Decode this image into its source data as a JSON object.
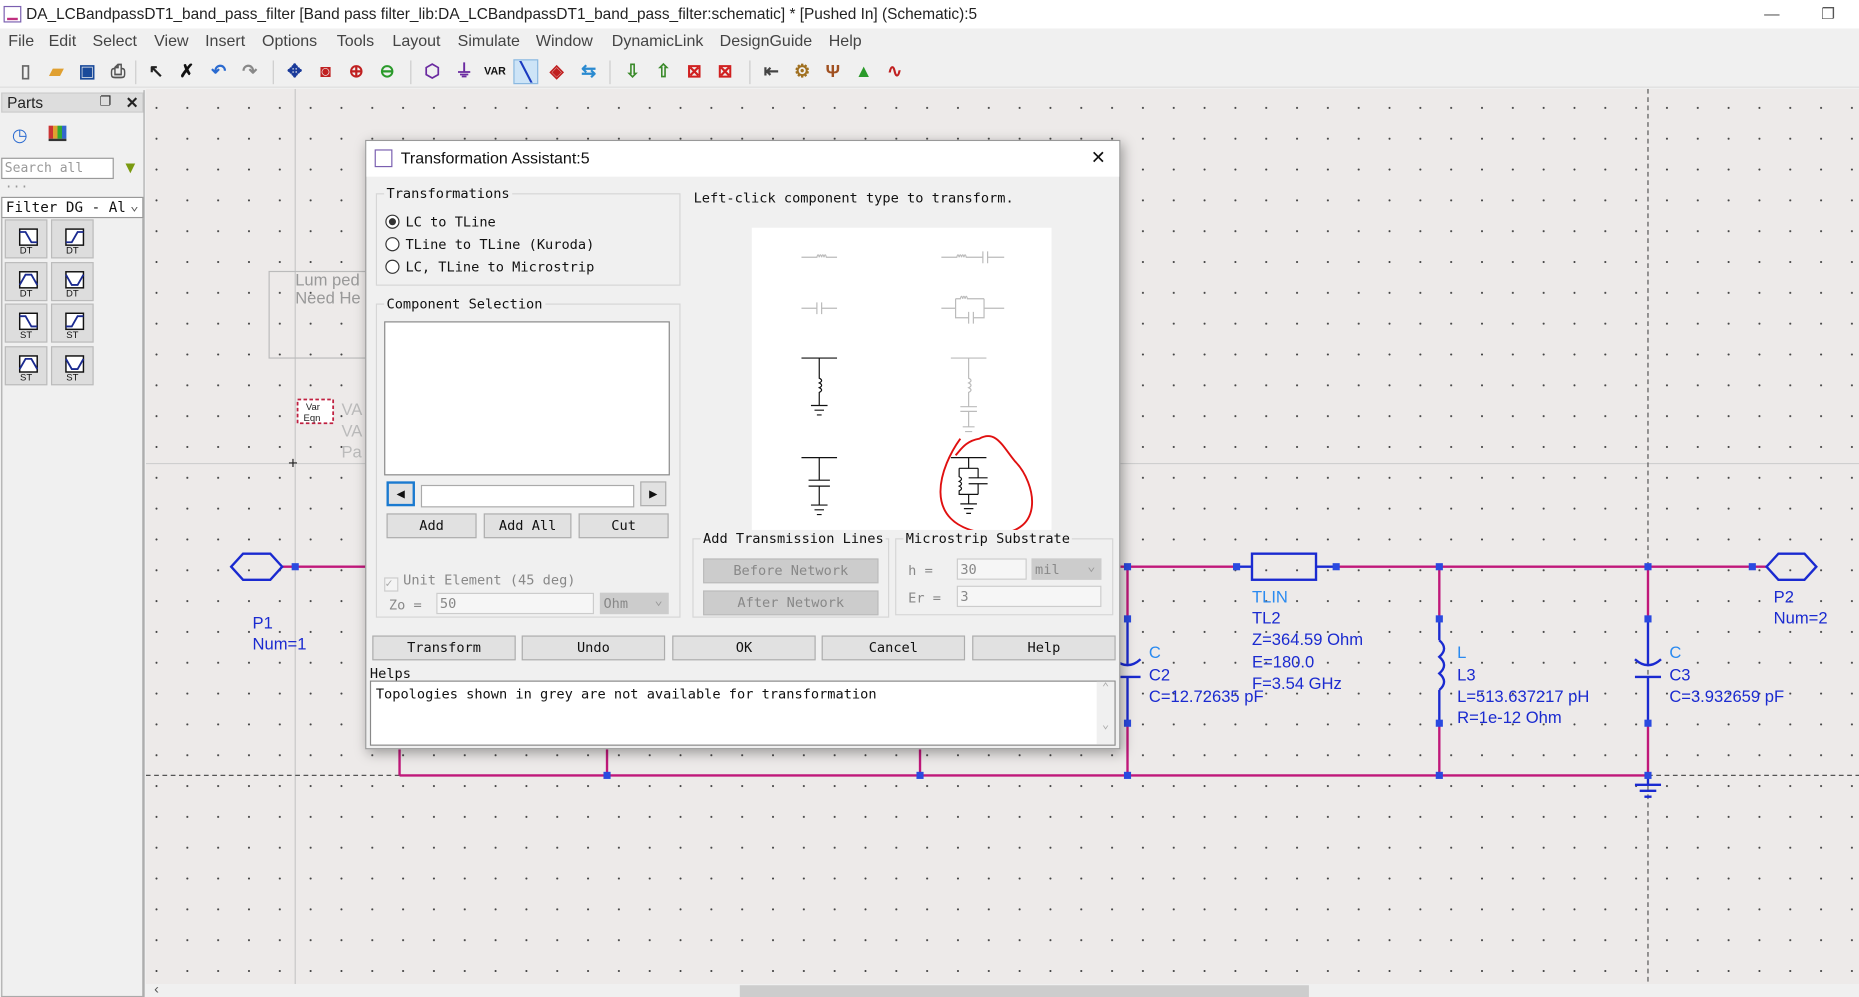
{
  "window": {
    "title": "DA_LCBandpassDT1_band_pass_filter [Band pass filter_lib:DA_LCBandpassDT1_band_pass_filter:schematic] * [Pushed In] (Schematic):5",
    "minimize": "—",
    "restore": "❐"
  },
  "menu": [
    "File",
    "Edit",
    "Select",
    "View",
    "Insert",
    "Options",
    "Tools",
    "Layout",
    "Simulate",
    "Window",
    "DynamicLink",
    "DesignGuide",
    "Help"
  ],
  "toolbar": [
    {
      "icon": "new-file-icon",
      "glyph": "▯",
      "color": "#666"
    },
    {
      "icon": "open-folder-icon",
      "glyph": "▰",
      "color": "#e0a030"
    },
    {
      "icon": "save-icon",
      "glyph": "▣",
      "color": "#1a4a9a"
    },
    {
      "icon": "print-icon",
      "glyph": "⎙",
      "color": "#555"
    },
    {
      "icon": "select-pointer-icon",
      "glyph": "↖",
      "color": "#222"
    },
    {
      "icon": "delete-icon",
      "glyph": "✗",
      "color": "#111"
    },
    {
      "icon": "undo-icon",
      "glyph": "↶",
      "color": "#2a6ad0"
    },
    {
      "icon": "redo-icon",
      "glyph": "↷",
      "color": "#888"
    },
    {
      "icon": "move-icon",
      "glyph": "✥",
      "color": "#1a3a9a"
    },
    {
      "icon": "zoom-area-icon",
      "glyph": "◙",
      "color": "#c02020"
    },
    {
      "icon": "zoom-in-icon",
      "glyph": "⊕",
      "color": "#c02020"
    },
    {
      "icon": "zoom-out-icon",
      "glyph": "⊖",
      "color": "#2a9a2a"
    },
    {
      "icon": "port-icon",
      "glyph": "⬡",
      "color": "#6a2aa0"
    },
    {
      "icon": "ground-icon",
      "glyph": "⏚",
      "color": "#6a2aa0"
    },
    {
      "icon": "var-icon",
      "glyph": "VAR",
      "color": "#111"
    },
    {
      "icon": "wire-icon",
      "glyph": "╲",
      "color": "#1a3ac0"
    },
    {
      "icon": "name-icon",
      "glyph": "◈",
      "color": "#c02020"
    },
    {
      "icon": "pin-icon",
      "glyph": "⇆",
      "color": "#2a8ad0"
    },
    {
      "icon": "push-into-icon",
      "glyph": "⇩",
      "color": "#3a8a2a"
    },
    {
      "icon": "pop-out-icon",
      "glyph": "⇧",
      "color": "#3a8a2a"
    },
    {
      "icon": "deactivate-icon",
      "glyph": "⊠",
      "color": "#d02020"
    },
    {
      "icon": "short-icon",
      "glyph": "⊠",
      "color": "#d02020"
    },
    {
      "icon": "generate-layout-icon",
      "glyph": "⇤",
      "color": "#444"
    },
    {
      "icon": "tuning-icon",
      "glyph": "⚙",
      "color": "#a07020"
    },
    {
      "icon": "tune-icon",
      "glyph": "Ψ",
      "color": "#a05020"
    },
    {
      "icon": "simulate-icon",
      "glyph": "▲",
      "color": "#2a9a2a"
    },
    {
      "icon": "data-display-icon",
      "glyph": "∿",
      "color": "#c02020"
    }
  ],
  "parts": {
    "title": "Parts",
    "search_placeholder": "Search all",
    "search_more": "···",
    "library": "Filter DG - All",
    "tiles": [
      {
        "label": "DT",
        "shape": "lowpass"
      },
      {
        "label": "DT",
        "shape": "highpass"
      },
      {
        "label": "DT",
        "shape": "bandpass"
      },
      {
        "label": "DT",
        "shape": "bandstop"
      },
      {
        "label": "ST",
        "shape": "lowpass"
      },
      {
        "label": "ST",
        "shape": "highpass"
      },
      {
        "label": "ST",
        "shape": "bandpass"
      },
      {
        "label": "ST",
        "shape": "bandstop"
      }
    ]
  },
  "schematic": {
    "lumped_note": [
      "Lum ped",
      "Need He"
    ],
    "vareqn": {
      "icon": [
        "Var",
        "Eqn"
      ],
      "lines": [
        "VA",
        "VA",
        "Pa"
      ]
    },
    "p1": {
      "name": "P1",
      "num": "Num=1"
    },
    "p2": {
      "name": "P2",
      "num": "Num=2"
    },
    "c2": {
      "type": "C",
      "name": "C2",
      "value": "C=12.72635 pF"
    },
    "tl2": {
      "type": "TLIN",
      "name": "TL2",
      "z": "Z=364.59 Ohm",
      "e": "E=180.0",
      "f": "F=3.54 GHz"
    },
    "l3": {
      "type": "L",
      "name": "L3",
      "l": "L=513.637217 pH",
      "r": "R=1e-12 Ohm"
    },
    "c3": {
      "type": "C",
      "name": "C3",
      "value": "C=3.932659 pF"
    },
    "colors": {
      "wire": "#c0187a",
      "component": "#1a2ad0",
      "label": "#1a2ad0",
      "type_label": "#2a8af0"
    }
  },
  "dialog": {
    "title": "Transformation Assistant:5",
    "close": "✕",
    "transformations": {
      "label": "Transformations",
      "options": [
        {
          "label": "LC to TLine",
          "selected": true
        },
        {
          "label": "TLine to TLine (Kuroda)",
          "selected": false
        },
        {
          "label": "LC, TLine to Microstrip",
          "selected": false
        }
      ]
    },
    "component_selection": {
      "label": "Component Selection",
      "items": [],
      "nav_value": "",
      "add": "Add",
      "add_all": "Add All",
      "cut": "Cut"
    },
    "unit_element": {
      "label": "Unit Element (45 deg)",
      "checked": true,
      "enabled": false
    },
    "zo": {
      "label": "Zo =",
      "value": "50",
      "unit": "Ohm"
    },
    "instruction": "Left-click component type to transform.",
    "add_tlines": {
      "label": "Add Transmission Lines",
      "before": "Before Network",
      "after": "After Network"
    },
    "substrate": {
      "label": "Microstrip Substrate",
      "h_label": "h =",
      "h_value": "30",
      "h_unit": "mil",
      "er_label": "Er =",
      "er_value": "3"
    },
    "buttons": {
      "transform": "Transform",
      "undo": "Undo",
      "ok": "OK",
      "cancel": "Cancel",
      "help": "Help"
    },
    "helps": {
      "label": "Helps",
      "text": "Topologies shown in grey are not available for transformation"
    },
    "annotation_color": "#e01010"
  }
}
